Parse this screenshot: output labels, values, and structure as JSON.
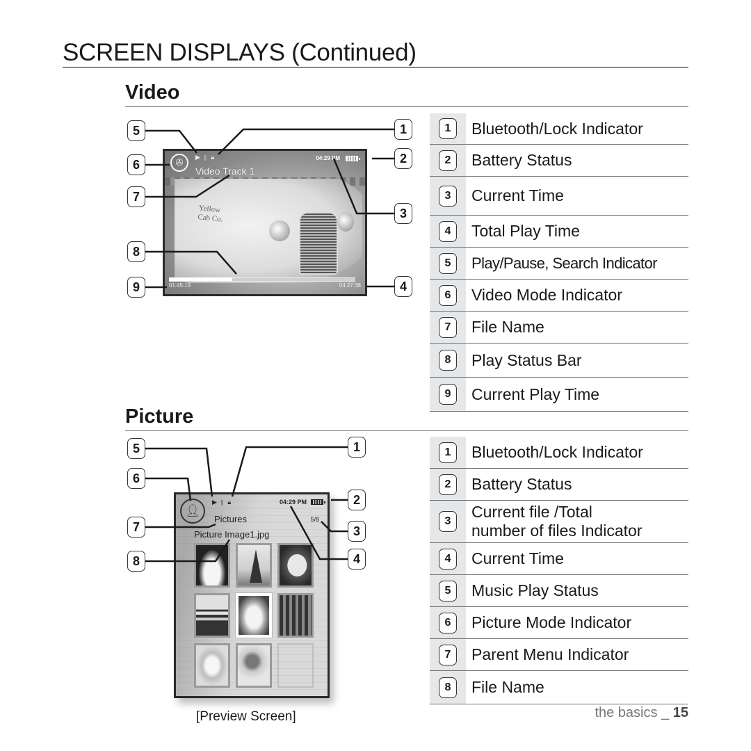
{
  "page": {
    "title": "SCREEN DISPLAYS (Continued)",
    "footer_section": "the basics",
    "footer_separator": "_",
    "page_number": "15"
  },
  "video": {
    "section_title": "Video",
    "screen": {
      "file_name": "Video Track 1",
      "clock": "04:29 PM",
      "current_play_time": "01:45:19",
      "total_play_time": "04:27:38",
      "progress_fraction": 0.34,
      "icons": [
        "play-icon",
        "bluetooth-icon",
        "lock-icon",
        "battery-icon",
        "video-mode-icon"
      ],
      "vehicle_text": [
        "Yellow",
        "Cab Co."
      ]
    },
    "callouts": [
      "1",
      "2",
      "3",
      "4",
      "5",
      "6",
      "7",
      "8",
      "9"
    ],
    "legend": [
      {
        "num": "1",
        "label": "Bluetooth/Lock Indicator"
      },
      {
        "num": "2",
        "label": "Battery Status"
      },
      {
        "num": "3",
        "label": "Current Time"
      },
      {
        "num": "4",
        "label": "Total Play Time"
      },
      {
        "num": "5",
        "label": "Play/Pause, Search Indicator"
      },
      {
        "num": "6",
        "label": "Video Mode Indicator"
      },
      {
        "num": "7",
        "label": "File Name"
      },
      {
        "num": "8",
        "label": "Play Status Bar"
      },
      {
        "num": "9",
        "label": "Current Play Time"
      }
    ]
  },
  "picture": {
    "section_title": "Picture",
    "screen": {
      "parent_menu": "Pictures",
      "file_name": "Picture Image1.jpg",
      "clock": "04:29 PM",
      "file_count": "5/8",
      "selected_thumbnail": 5,
      "thumbnails": [
        "cat",
        "eiffel-tower",
        "dog",
        "pagoda",
        "vintage-truck",
        "storefront",
        "seal",
        "child",
        ""
      ],
      "icons": [
        "play-icon",
        "bluetooth-icon",
        "lock-icon",
        "battery-icon",
        "picture-mode-icon"
      ]
    },
    "caption": "[Preview Screen]",
    "callouts": [
      "1",
      "2",
      "3",
      "4",
      "5",
      "6",
      "7",
      "8"
    ],
    "legend": [
      {
        "num": "1",
        "label": "Bluetooth/Lock Indicator"
      },
      {
        "num": "2",
        "label": "Battery Status"
      },
      {
        "num": "3",
        "label": "Current file /Total",
        "label_line2": "number of files Indicator"
      },
      {
        "num": "4",
        "label": "Current Time"
      },
      {
        "num": "5",
        "label": "Music Play Status"
      },
      {
        "num": "6",
        "label": "Picture Mode Indicator"
      },
      {
        "num": "7",
        "label": "Parent Menu Indicator"
      },
      {
        "num": "8",
        "label": "File Name"
      }
    ]
  }
}
